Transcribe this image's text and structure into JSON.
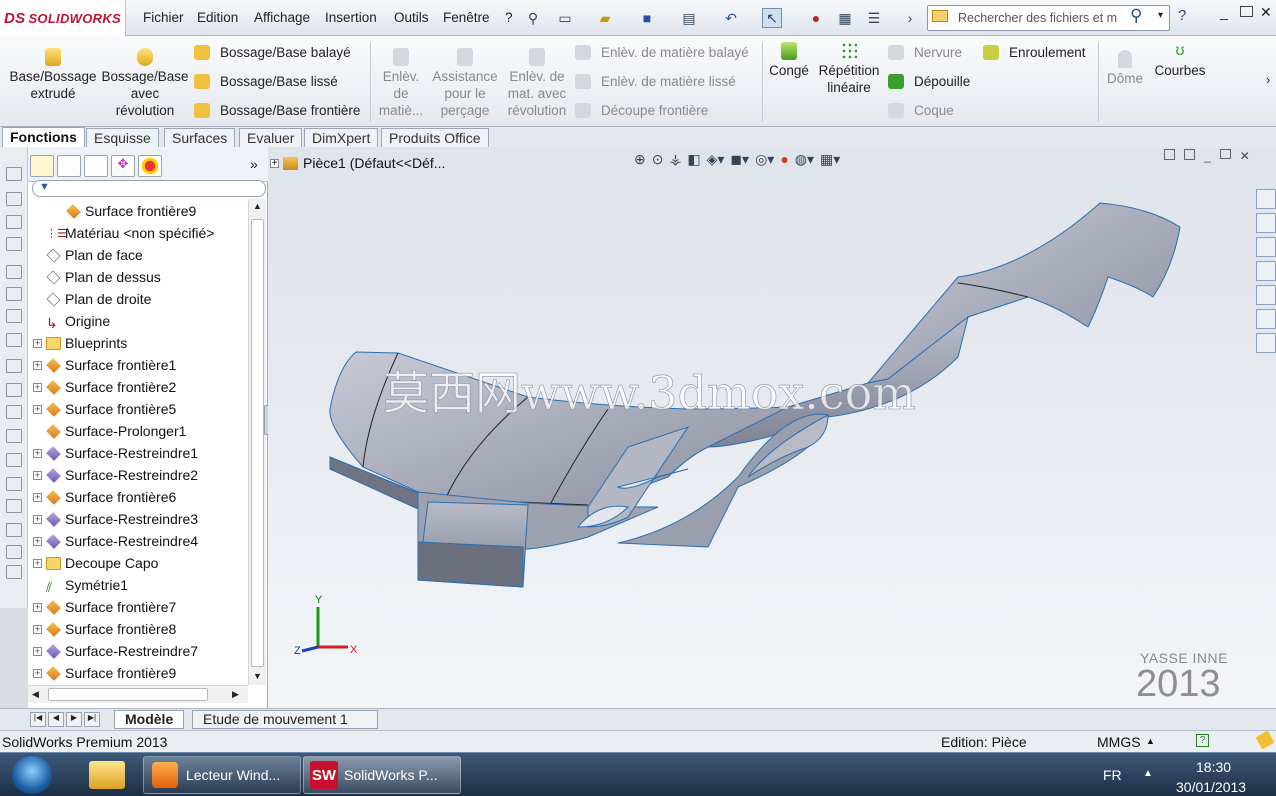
{
  "app": {
    "logo": "SOLIDWORKS",
    "logo_mark": "DS"
  },
  "menu": [
    "Fichier",
    "Edition",
    "Affichage",
    "Insertion",
    "Outils",
    "Fenêtre",
    "?"
  ],
  "search": {
    "placeholder": "Rechercher des fichiers et m"
  },
  "command_manager": {
    "big_buttons": [
      {
        "label1": "Base/Bossage",
        "label2": "extrudé",
        "label3": ""
      },
      {
        "label1": "Bossage/Base",
        "label2": "avec",
        "label3": "révolution"
      },
      {
        "label1": "Enlèv.",
        "label2": "de",
        "label3": "matiè..."
      },
      {
        "label1": "Assistance",
        "label2": "pour le",
        "label3": "perçage"
      },
      {
        "label1": "Enlèv. de",
        "label2": "mat. avec",
        "label3": "révolution"
      },
      {
        "label1": "Congé",
        "label2": "",
        "label3": ""
      },
      {
        "label1": "Répétition",
        "label2": "linéaire",
        "label3": ""
      },
      {
        "label1": "Dôme",
        "label2": "",
        "label3": ""
      },
      {
        "label1": "Courbes",
        "label2": "",
        "label3": ""
      }
    ],
    "rows_boss": [
      "Bossage/Base balayé",
      "Bossage/Base lissé",
      "Bossage/Base frontière"
    ],
    "rows_cut": [
      "Enlèv. de matière balayé",
      "Enlèv. de matière lissé",
      "Découpe frontière"
    ],
    "rows_feat": [
      "Nervure",
      "Dépouille",
      "Coque"
    ],
    "wrap": "Enroulement"
  },
  "tabs": [
    "Fonctions",
    "Esquisse",
    "Surfaces",
    "Evaluer",
    "DimXpert",
    "Produits Office"
  ],
  "tree": [
    {
      "label": "Surface frontière9",
      "type": "surf",
      "exp": false,
      "indent": 1
    },
    {
      "label": "Matériau <non spécifié>",
      "type": "mat",
      "exp": false,
      "indent": 0
    },
    {
      "label": "Plan de face",
      "type": "plane",
      "exp": false,
      "indent": 0
    },
    {
      "label": "Plan de dessus",
      "type": "plane",
      "exp": false,
      "indent": 0
    },
    {
      "label": "Plan de droite",
      "type": "plane",
      "exp": false,
      "indent": 0
    },
    {
      "label": "Origine",
      "type": "origin",
      "exp": false,
      "indent": 0
    },
    {
      "label": "Blueprints",
      "type": "folder",
      "exp": true,
      "indent": 0
    },
    {
      "label": "Surface frontière1",
      "type": "surf",
      "exp": true,
      "indent": 0
    },
    {
      "label": "Surface frontière2",
      "type": "surf",
      "exp": true,
      "indent": 0
    },
    {
      "label": "Surface frontière5",
      "type": "surf",
      "exp": true,
      "indent": 0
    },
    {
      "label": "Surface-Prolonger1",
      "type": "surf",
      "exp": false,
      "indent": 0
    },
    {
      "label": "Surface-Restreindre1",
      "type": "trim",
      "exp": true,
      "indent": 0
    },
    {
      "label": "Surface-Restreindre2",
      "type": "trim",
      "exp": true,
      "indent": 0
    },
    {
      "label": "Surface frontière6",
      "type": "surf",
      "exp": true,
      "indent": 0
    },
    {
      "label": "Surface-Restreindre3",
      "type": "trim",
      "exp": true,
      "indent": 0
    },
    {
      "label": "Surface-Restreindre4",
      "type": "trim",
      "exp": true,
      "indent": 0
    },
    {
      "label": "Decoupe Capo",
      "type": "folder",
      "exp": true,
      "indent": 0
    },
    {
      "label": "Symétrie1",
      "type": "sym",
      "exp": false,
      "indent": 0
    },
    {
      "label": "Surface frontière7",
      "type": "surf",
      "exp": true,
      "indent": 0
    },
    {
      "label": "Surface frontière8",
      "type": "surf",
      "exp": true,
      "indent": 0
    },
    {
      "label": "Surface-Restreindre7",
      "type": "trim",
      "exp": true,
      "indent": 0
    },
    {
      "label": "Surface frontière9",
      "type": "surf",
      "exp": true,
      "indent": 0
    }
  ],
  "viewport": {
    "part_title": "Pièce1  (Défaut<<Déf...",
    "watermark": "莫西网www.3dmox.com",
    "signature": "YASSE INNE",
    "year": "2013",
    "axes": {
      "x": "X",
      "y": "Y",
      "z": "Z"
    }
  },
  "bottom_tabs": [
    "Modèle",
    "Etude de mouvement 1"
  ],
  "status": {
    "product": "SolidWorks Premium 2013",
    "edition": "Edition: Pièce",
    "units": "MMGS"
  },
  "taskbar": {
    "apps": [
      "Lecteur Wind...",
      "SolidWorks P..."
    ],
    "lang": "FR",
    "time": "18:30",
    "date": "30/01/2013"
  }
}
